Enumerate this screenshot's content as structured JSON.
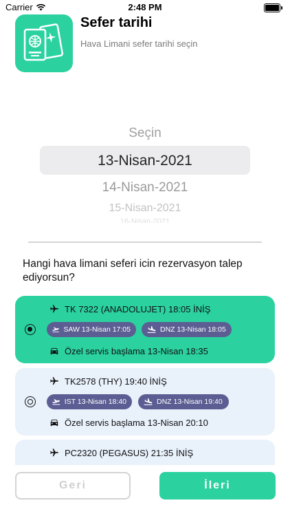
{
  "status_bar": {
    "carrier": "Carrier",
    "time": "2:48 PM"
  },
  "header": {
    "title": "Sefer tarihi",
    "subtitle": "Hava Limani sefer tarihi seçin"
  },
  "picker": {
    "label": "Seçin",
    "selected": "13-Nisan-2021",
    "next1": "14-Nisan-2021",
    "next2": "15-Nisan-2021",
    "next3": "16-Nisan-2021"
  },
  "question": "Hangi hava limani seferi icin rezervasyon talep ediyorsun?",
  "flights": [
    {
      "selected": true,
      "title": "TK 7322 (ANADOLUJET) 18:05 İNİŞ",
      "departure": "SAW 13-Nisan  17:05",
      "arrival": "DNZ 13-Nisan  18:05",
      "service": "Özel servis başlama 13-Nisan  18:35"
    },
    {
      "selected": false,
      "title": "TK2578 (THY) 19:40 İNİŞ",
      "departure": "IST 13-Nisan  18:40",
      "arrival": "DNZ 13-Nisan  19:40",
      "service": "Özel servis başlama 13-Nisan  20:10"
    },
    {
      "selected": false,
      "title": "PC2320 (PEGASUS) 21:35 İNİŞ"
    }
  ],
  "buttons": {
    "back": "Geri",
    "next": "İleri"
  },
  "colors": {
    "accent": "#2bd2a0",
    "card_bg": "#e9f1fb",
    "pill_bg": "#5c5d92"
  }
}
